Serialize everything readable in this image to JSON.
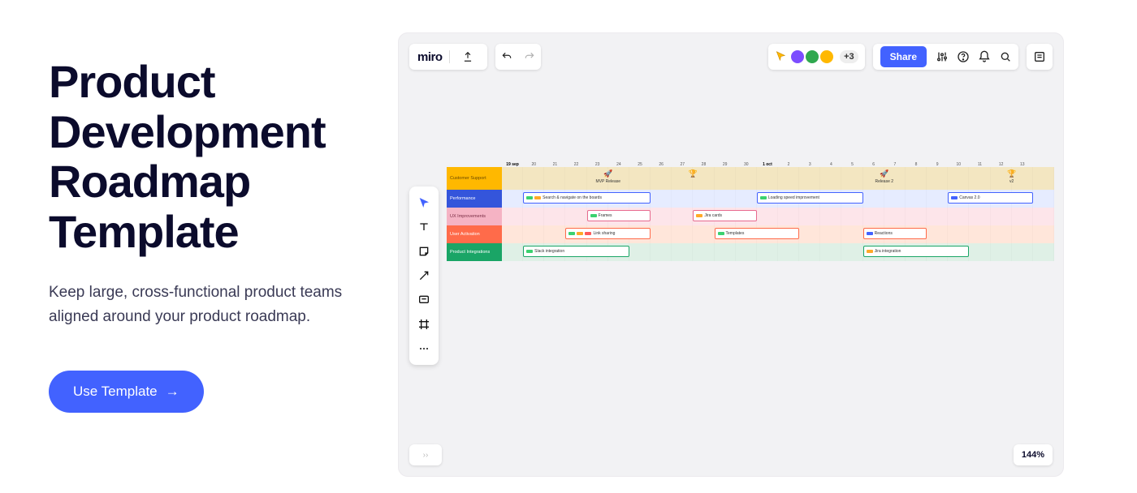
{
  "left": {
    "headline": "Product Development Roadmap Template",
    "sub": "Keep large, cross-functional product teams aligned around your product roadmap.",
    "cta_label": "Use Template",
    "cta_arrow": "→"
  },
  "toolbar": {
    "logo": "miro",
    "share_label": "Share",
    "more_count": "+3",
    "zoom": "144%",
    "minimap_hint": "››"
  },
  "avatars": {
    "a1_color": "#7c4dff",
    "a2_color": "#2fa84f",
    "a3_color": "#ffb800"
  },
  "timeline": {
    "start_label": "19 sep",
    "days": [
      "19 sep",
      "20",
      "21",
      "22",
      "23",
      "24",
      "25",
      "26",
      "27",
      "28",
      "29",
      "30",
      "1 oct",
      "2",
      "3",
      "4",
      "5",
      "6",
      "7",
      "8",
      "9",
      "10",
      "11",
      "12",
      "13"
    ]
  },
  "lanes": {
    "support": {
      "label": "Customer Support"
    },
    "performance": {
      "label": "Performance"
    },
    "ux": {
      "label": "UX Improvements"
    },
    "activation": {
      "label": "User Activation"
    },
    "integrations": {
      "label": "Product Integrations"
    }
  },
  "milestones": [
    {
      "icon": "🚀",
      "label": "MVP Release",
      "col": 5
    },
    {
      "icon": "🏆",
      "label": "",
      "col": 9
    },
    {
      "icon": "🚀",
      "label": "Release 2",
      "col": 18
    },
    {
      "icon": "🏆",
      "label": "v2",
      "col": 24
    }
  ],
  "tasks": {
    "performance": [
      {
        "label": "Search & navigate on the boards",
        "start": 1,
        "span": 6,
        "chips": [
          "g",
          "o"
        ]
      },
      {
        "label": "Loading speed improvement",
        "start": 12,
        "span": 5,
        "chips": [
          "g"
        ]
      },
      {
        "label": "Canvas 2.0",
        "start": 21,
        "span": 4,
        "chips": [
          "b"
        ]
      }
    ],
    "ux": [
      {
        "label": "Frames",
        "start": 4,
        "span": 3,
        "chips": [
          "g"
        ]
      },
      {
        "label": "Jira cards",
        "start": 9,
        "span": 3,
        "chips": [
          "o"
        ]
      }
    ],
    "activation": [
      {
        "label": "Link sharing",
        "start": 3,
        "span": 4,
        "chips": [
          "g",
          "o",
          "r"
        ]
      },
      {
        "label": "Templates",
        "start": 10,
        "span": 4,
        "chips": [
          "g"
        ]
      },
      {
        "label": "Reactions",
        "start": 17,
        "span": 3,
        "chips": [
          "b"
        ]
      }
    ],
    "integrations": [
      {
        "label": "Slack integration",
        "start": 1,
        "span": 5,
        "chips": [
          "g"
        ]
      },
      {
        "label": "Jira integration",
        "start": 17,
        "span": 5,
        "chips": [
          "o"
        ]
      }
    ]
  }
}
